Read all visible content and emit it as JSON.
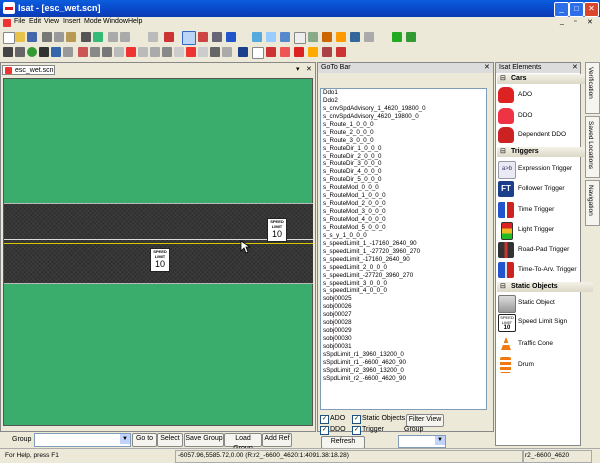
{
  "window": {
    "title": "Isat - [esc_wet.scn]"
  },
  "menu": [
    "File",
    "Edit",
    "View",
    "Insert",
    "Mode",
    "Window",
    "Help"
  ],
  "scene": {
    "tab_label": "esc_wet.scn"
  },
  "signs": [
    {
      "label": "SPEED\nLIMIT",
      "value": "10"
    },
    {
      "label": "SPEED\nLIMIT",
      "value": "10"
    }
  ],
  "group_bar": {
    "label": "Group",
    "buttons": [
      "Go to",
      "Select",
      "Save Group",
      "Load Group",
      "Add Ref"
    ]
  },
  "goto": {
    "title": "GoTo Bar",
    "items": [
      "Ddo1",
      "Ddo2",
      "s_cnvSpdAdvisory_1_4620_19800_0",
      "s_cnvSpdAdvisory_4620_19800_0",
      "s_Route_1_0_0_0",
      "s_Route_2_0_0_0",
      "s_Route_3_0_0_0",
      "s_RouteDir_1_0_0_0",
      "s_RouteDir_2_0_0_0",
      "s_RouteDir_3_0_0_0",
      "s_RouteDir_4_0_0_0",
      "s_RouteDir_5_0_0_0",
      "s_RouteMod_0_0_0",
      "s_RouteMod_1_0_0_0",
      "s_RouteMod_2_0_0_0",
      "s_RouteMod_3_0_0_0",
      "s_RouteMod_4_0_0_0",
      "s_RouteMod_5_0_0_0",
      "s_s_y_1_0_0_0",
      "s_speedLimit_1_-17160_2640_90",
      "s_speedLimit_1_-27720_3960_270",
      "s_speedLimit_-17160_2640_90",
      "s_speedLimit_2_0_0_0",
      "s_speedLimit_-27720_3960_270",
      "s_speedLimit_3_0_0_0",
      "s_speedLimit_4_0_0_0",
      "sobj00025",
      "sobj00026",
      "sobj00027",
      "sobj00028",
      "sobj00029",
      "sobj00030",
      "sobj00031",
      "sSpdLimit_r1_3960_13200_0",
      "sSpdLimit_r1_-6600_4620_90",
      "sSpdLimit_r2_3960_13200_0",
      "sSpdLimit_r2_-6600_4620_90"
    ],
    "filters": [
      {
        "label": "ADO",
        "checked": true
      },
      {
        "label": "Static Objects",
        "checked": true
      },
      {
        "label": "DDO",
        "checked": true
      },
      {
        "label": "Trigger",
        "checked": true
      }
    ],
    "filter_view": "Filter View",
    "refresh": "Refresh",
    "group_label": "Group"
  },
  "elements": {
    "title": "Isat Elements",
    "categories": [
      {
        "name": "Cars",
        "items": [
          "ADO",
          "DDO",
          "Dependent DDO"
        ]
      },
      {
        "name": "Triggers",
        "items": [
          "Expression Trigger",
          "Follower Trigger",
          "Time Trigger",
          "Light Trigger",
          "Road-Pad Trigger",
          "Time-To-Arv. Trigger"
        ]
      },
      {
        "name": "Static Objects",
        "items": [
          "Static Object",
          "Speed Limit Sign",
          "Traffic Cone",
          "Drum"
        ]
      }
    ]
  },
  "side_tabs": [
    "Verification",
    "Saved Locations",
    "Navigation"
  ],
  "status": {
    "help": "For Help, press F1",
    "coords": "-6057.96,5585.72,0.00 (R:r2_-6600_4620:1:4091.38:18.28)",
    "object": "r2_-6600_4620"
  },
  "colors": {
    "grass": "#3aad6c",
    "road": "#2e2e2e",
    "title_bar": "#0a5ddd"
  }
}
